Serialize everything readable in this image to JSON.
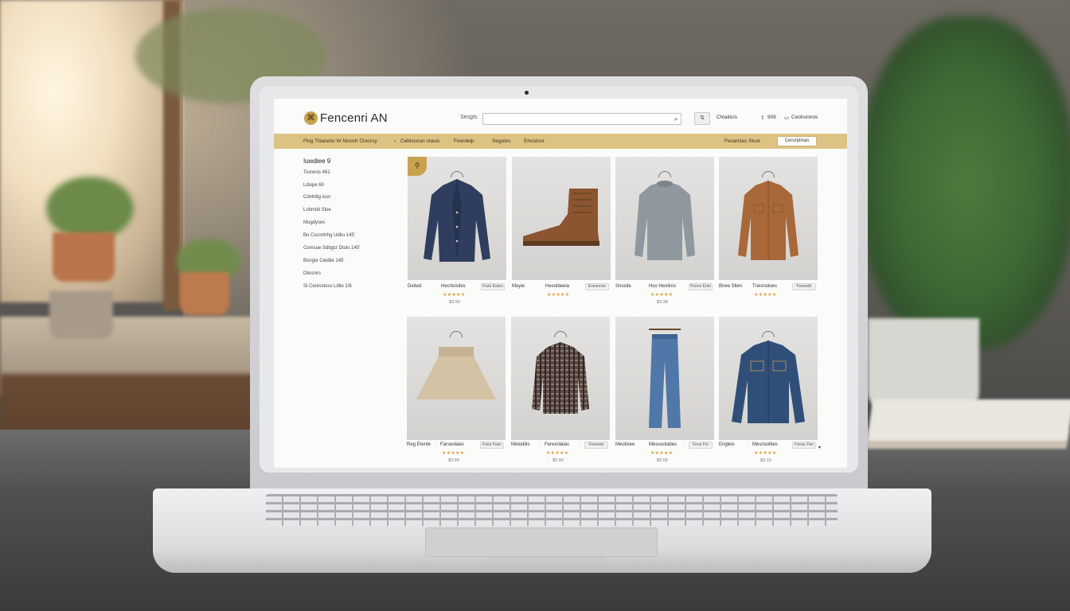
{
  "header": {
    "logo_text": "Fencenri AN",
    "logo_icon": "hanger-icon",
    "search_label": "Sesgts",
    "search_placeholder": "",
    "links": [
      "Chiaiticis",
      "906",
      "Ceohoniros"
    ]
  },
  "navbar": {
    "items": [
      "Fkig Tliianeiio W Nosotr Clooroy",
      "Cebiscoun stasis",
      "Feerdelp",
      "Seguies",
      "Ehustnor"
    ],
    "right_link": "Fesarclas Stusr",
    "right_button": "Cerurpiinas"
  },
  "sidebar": {
    "title": "Iuwdiee 9",
    "items": [
      "Tssrenis 461",
      "Ldsipe 60",
      "Cdnhlitg issn",
      "Lohnsbi Slue",
      "Mugdyses",
      "Bo Cscontrhg Uditu 145'",
      "Comsue Sdbgcr Dtols 145'",
      "Bongie Ceidiie 145'",
      "Dtesnirs",
      "Si Ceoisstosv Ldlie 1/6"
    ]
  },
  "products": [
    {
      "name": "Deited",
      "sub": "Hecrloisiles",
      "button": "Fsee Eaton",
      "price": "$3.99"
    },
    {
      "name": "Mayie",
      "sub": "Hesoldeeia",
      "button": "Eseonnse",
      "price": ""
    },
    {
      "name": "Snoslie",
      "sub": "Hso Heolinio",
      "button": "Feone Ento",
      "price": "$3.38"
    },
    {
      "name": "Bnee Slien",
      "sub": "Tnesnoloes",
      "button": "Feesniln",
      "price": ""
    },
    {
      "name": "Reg Etente",
      "sub": "Farseolaes",
      "button": "Foes Foan",
      "price": "$9.99"
    },
    {
      "name": "Melodiiis",
      "sub": "Ferexolaias",
      "button": "Feseniin",
      "price": "$5.90"
    },
    {
      "name": "Meotisee",
      "sub": "Mesusolaties",
      "button": "Feoe Fio",
      "price": "$3.00"
    },
    {
      "name": "Engleis",
      "sub": "Mesnsolites",
      "button": "Feose Fan",
      "price": "$3.19"
    }
  ],
  "rating": "★★★★★",
  "colors": {
    "accent": "#ddc383",
    "badge": "#c8a24e",
    "stars": "#d9a23b"
  }
}
